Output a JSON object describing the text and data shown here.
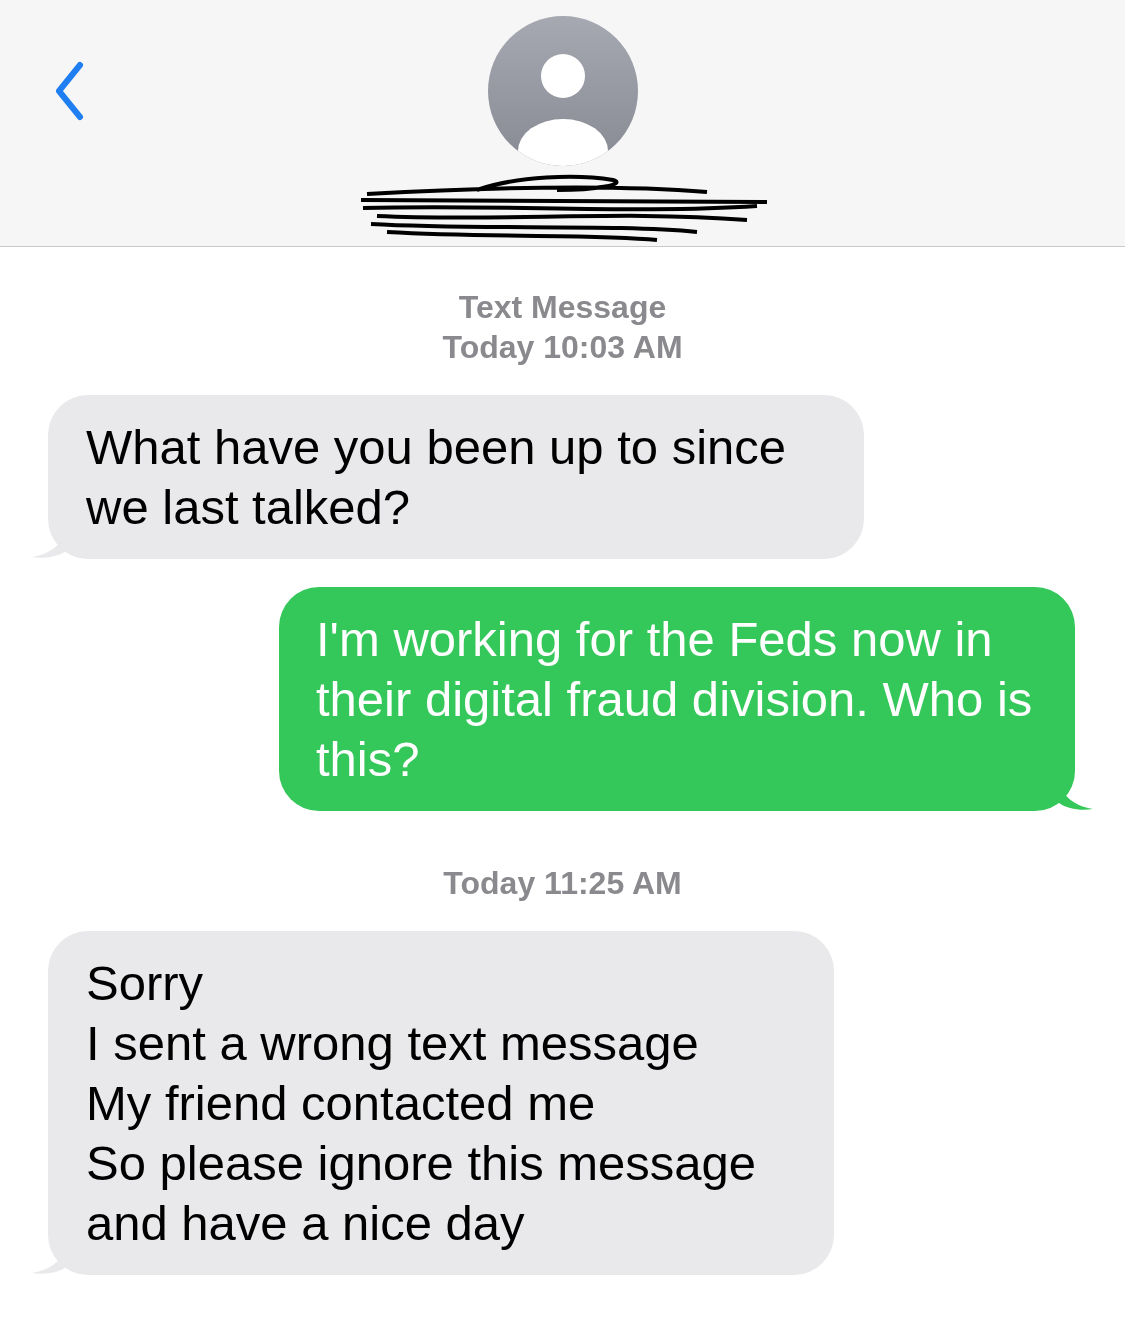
{
  "thread": [
    {
      "kind": "timestamp",
      "lines": [
        "Text Message",
        "Today 10:03 AM"
      ]
    },
    {
      "kind": "incoming",
      "text": "What have you been up to since we last talked?"
    },
    {
      "kind": "outgoing",
      "text": "I'm working for the Feds now in their digital fraud division. Who is this?"
    },
    {
      "kind": "timestamp",
      "lines": [
        "Today 11:25 AM"
      ]
    },
    {
      "kind": "incoming",
      "text": "Sorry\nI sent a wrong text message\nMy friend contacted me\nSo please ignore this message\nand have a nice day"
    }
  ]
}
